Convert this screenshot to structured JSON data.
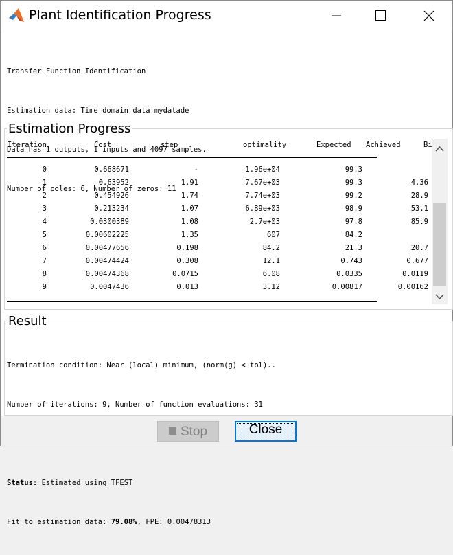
{
  "window": {
    "title": "Plant Identification Progress",
    "icons": {
      "app": "matlab-logo-icon",
      "minimize": "minimize-icon",
      "maximize": "maximize-icon",
      "close": "close-icon"
    }
  },
  "info": {
    "lines": [
      "Transfer Function Identification",
      "Estimation data: Time domain data mydatade",
      "Data has 1 outputs, 1 inputs and 4097 samples.",
      "Number of poles: 6, Number of zeros: 11"
    ]
  },
  "estimation": {
    "title": "Estimation Progress",
    "columns": [
      "Iteration",
      "Cost",
      "step",
      "optimality",
      "Expected",
      "Achieved",
      "Bi"
    ],
    "rows": [
      [
        "0",
        "0.668671",
        "-",
        "1.96e+04",
        "99.3",
        "",
        ""
      ],
      [
        "1",
        "0.63952",
        "1.91",
        "7.67e+03",
        "99.3",
        "4.36",
        ""
      ],
      [
        "2",
        "0.454926",
        "1.74",
        "7.74e+03",
        "99.2",
        "28.9",
        ""
      ],
      [
        "3",
        "0.213234",
        "1.07",
        "6.89e+03",
        "98.9",
        "53.1",
        ""
      ],
      [
        "4",
        "0.0300389",
        "1.08",
        "2.7e+03",
        "97.8",
        "85.9",
        ""
      ],
      [
        "5",
        "0.00602225",
        "1.35",
        "607",
        "84.2",
        "",
        ""
      ],
      [
        "6",
        "0.00477656",
        "0.198",
        "84.2",
        "21.3",
        "20.7",
        ""
      ],
      [
        "7",
        "0.00474424",
        "0.308",
        "12.1",
        "0.743",
        "0.677",
        ""
      ],
      [
        "8",
        "0.00474368",
        "0.0715",
        "6.08",
        "0.0335",
        "0.0119",
        ""
      ],
      [
        "9",
        "0.0047436",
        "0.013",
        "3.12",
        "0.00817",
        "0.00162",
        ""
      ]
    ]
  },
  "result": {
    "title": "Result",
    "termination": "Termination condition: Near (local) minimum, (norm(g) < tol)..",
    "iterations": "Number of iterations: 9, Number of function evaluations: 31",
    "status_label": "Status:",
    "status_value": " Estimated using TFEST",
    "fit_prefix": "Fit to estimation data: ",
    "fit_value": "79.08%",
    "fit_suffix": ", FPE: 0.00478313"
  },
  "buttons": {
    "stop": "Stop",
    "close": "Close"
  },
  "colors": {
    "accent": "#0078d7",
    "disabled_bg": "#cccccc"
  }
}
